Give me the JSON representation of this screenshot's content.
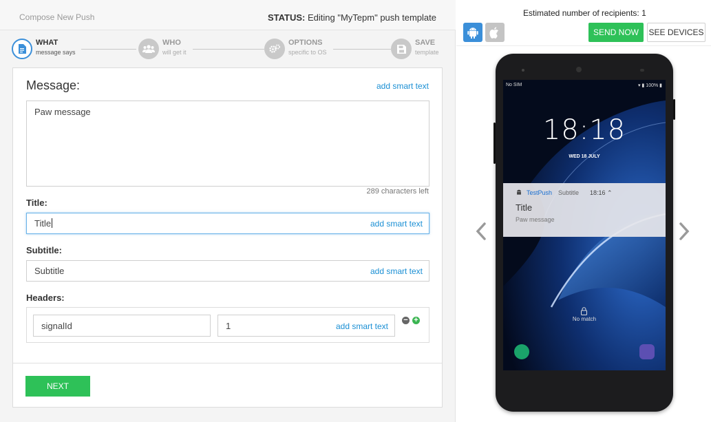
{
  "topbar": {
    "title": "Compose New Push",
    "status_label": "STATUS:",
    "status_text": " Editing \"MyTepm\" push template"
  },
  "steps": [
    {
      "title": "WHAT",
      "sub": "message says",
      "icon": "document-icon",
      "active": true
    },
    {
      "title": "WHO",
      "sub": "will get it",
      "icon": "users-icon",
      "active": false
    },
    {
      "title": "OPTIONS",
      "sub": "specific to OS",
      "icon": "gears-icon",
      "active": false
    },
    {
      "title": "SAVE",
      "sub": "template",
      "icon": "save-icon",
      "active": false
    }
  ],
  "form": {
    "message_label": "Message:",
    "smart_text": "add smart text",
    "message_value": "Paw message",
    "chars_left": "289 characters left",
    "title_label": "Title:",
    "title_value": "Title",
    "subtitle_label": "Subtitle:",
    "subtitle_value": "Subtitle",
    "headers_label": "Headers:",
    "header_key": "signalId",
    "header_value": "1",
    "next_label": "NEXT"
  },
  "preview": {
    "estimated": "Estimated number of recipients: 1",
    "send_now": "SEND NOW",
    "see_devices": "SEE DEVICES",
    "carrier": "No SIM",
    "battery": "100%",
    "clock": "18:18",
    "date": "WED 18 JULY",
    "notif_app": "TestPush",
    "notif_subtitle": "Subtitle",
    "notif_time": "18:16",
    "notif_title": "Title",
    "notif_body": "Paw message",
    "lock_text": "No match"
  },
  "colors": {
    "accent_blue": "#3b8fd9",
    "link_blue": "#1a8fd4",
    "green": "#2ec158"
  }
}
